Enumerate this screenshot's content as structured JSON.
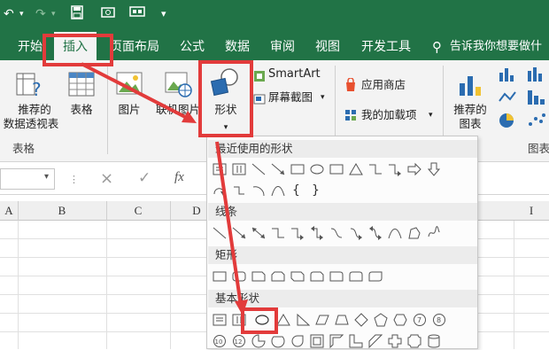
{
  "title_bar": {
    "icons": [
      "undo-icon",
      "redo-icon",
      "save-icon",
      "camera-icon",
      "presentation-icon",
      "customize-icon"
    ]
  },
  "tabs": [
    {
      "label": "开始"
    },
    {
      "label": "插入",
      "active": true
    },
    {
      "label": "页面布局"
    },
    {
      "label": "公式"
    },
    {
      "label": "数据"
    },
    {
      "label": "审阅"
    },
    {
      "label": "视图"
    },
    {
      "label": "开发工具"
    }
  ],
  "tell_me": "告诉我你想要做什",
  "ribbon": {
    "recommended_pivot_line1": "推荐的",
    "recommended_pivot_line2": "数据透视表",
    "table": "表格",
    "tables_group": "表格",
    "picture": "图片",
    "online_picture": "联机图片",
    "shapes": "形状",
    "smartart": "SmartArt",
    "screenshot": "屏幕截图",
    "app_store": "应用商店",
    "my_addins": "我的加载项",
    "recommended_charts_line1": "推荐的",
    "recommended_charts_line2": "图表",
    "charts_group": "图表"
  },
  "formula_bar": {
    "cancel": "×",
    "enter": "✓",
    "fx": "fx"
  },
  "columns": [
    "A",
    "B",
    "C",
    "D",
    "I"
  ],
  "shapes_menu": {
    "sections": [
      "最近使用的形状",
      "线条",
      "矩形",
      "基本形状"
    ],
    "recent_row2": [
      "{",
      "}"
    ]
  },
  "colors": {
    "excel_green": "#217346",
    "highlight_red": "#e23b3b"
  }
}
